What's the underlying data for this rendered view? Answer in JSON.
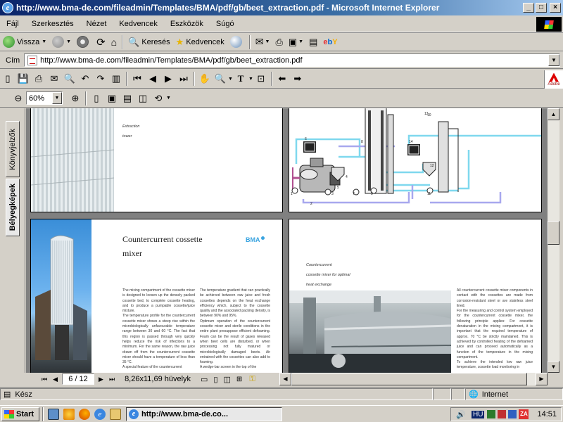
{
  "window": {
    "title": "http://www.bma-de.com/fileadmin/Templates/BMA/pdf/gb/beet_extraction.pdf - Microsoft Internet Explorer",
    "minimize": "_",
    "maximize": "□",
    "close": "×"
  },
  "menu": [
    "Fájl",
    "Szerkesztés",
    "Nézet",
    "Kedvencek",
    "Eszközök",
    "Súgó"
  ],
  "nav": {
    "back_label": "Vissza",
    "search_label": "Keresés",
    "favorites_label": "Kedvencek"
  },
  "address": {
    "label": "Cím",
    "url": "http://www.bma-de.com/fileadmin/Templates/BMA/pdf/gb/beet_extraction.pdf"
  },
  "pdf": {
    "zoom": "60%",
    "adobe_label": "Adobe",
    "tabs": [
      "Könyvjelzők",
      "Bélyegképek"
    ],
    "page_indicator": "6 / 12",
    "page_size": "8,26x11,69 hüvelyk",
    "page1": {
      "caption_lines": [
        "Extraction",
        "tower"
      ]
    },
    "page3": {
      "heading_lines": [
        "Countercurrent cossette",
        "mixer"
      ],
      "logo": "BMA",
      "col1": [
        "The mixing compartment of the cossette mixer is designed to loosen up the densely packed cossette bed, to complete cossette heating, and to produce a pumpable cossette/juice mixture.",
        "The temperature profile for the countercurrent cossette mixer shows a steep rise within the microbiologically unfavourable temperature range between 30 and 60 °C. The fact that this region is passed through very quickly helps reduce the risk of infections to a minimum. For the same reason, the raw juice drawn off from the countercurrent cossette mixer should have a temperature of less than 35 °C.",
        "A special feature of the countercurrent"
      ],
      "col2": [
        "The temperature gradient that can practically be achieved between raw juice and fresh cossettes depends on the heat exchange efficiency which, subject to the cossette quality and the associated packing density, is between 90% and 95%.",
        "Optimum operation of the countercurrent cossette mixer and sterile conditions in the entire plant presuppose efficient defoaming. Foam can be the result of gases released when beet cells are disturbed, or when processing not fully matured or microbiologically damaged beets. Air entrained with the cossettes can also add to foaming.",
        "A wedge-bar screen in the top of the"
      ]
    },
    "page4": {
      "caption_lines": [
        "Countercurrent",
        "cossette mixer for optimal",
        "heat exchange"
      ],
      "col": [
        "All countercurrent cossette mixer components in contact with the cossettes are made from corrosion-resistant steel or are stainless steel lined.",
        "For the measuring and control system employed for the countercurrent cossette mixer, the following principle applies: For cossette denaturation in the mixing compartment, it is important that the required temperature of approx. 70 °C be strictly maintained. This is achieved by controlled heating of the defoamed juice and can proceed automatically as a function of the temperature in the mixing compartment.",
        "To achieve the intended low raw juice temperature, cossette load monitoring in"
      ]
    },
    "diagram_numbers": [
      "1",
      "2",
      "3",
      "4",
      "5",
      "6",
      "7",
      "8",
      "9",
      "10",
      "11",
      "12",
      "13",
      "14"
    ]
  },
  "status": {
    "text": "Kész",
    "zone": "Internet"
  },
  "taskbar": {
    "start": "Start",
    "item": "http://www.bma-de.co...",
    "lang": "HU",
    "clock": "14:51"
  },
  "colors": {
    "title_start": "#0a246a",
    "title_end": "#a6caf0",
    "pipe_cyan": "#7fd8ee",
    "pipe_violet": "#a8a8ee",
    "bma_blue": "#3aa4e0"
  }
}
